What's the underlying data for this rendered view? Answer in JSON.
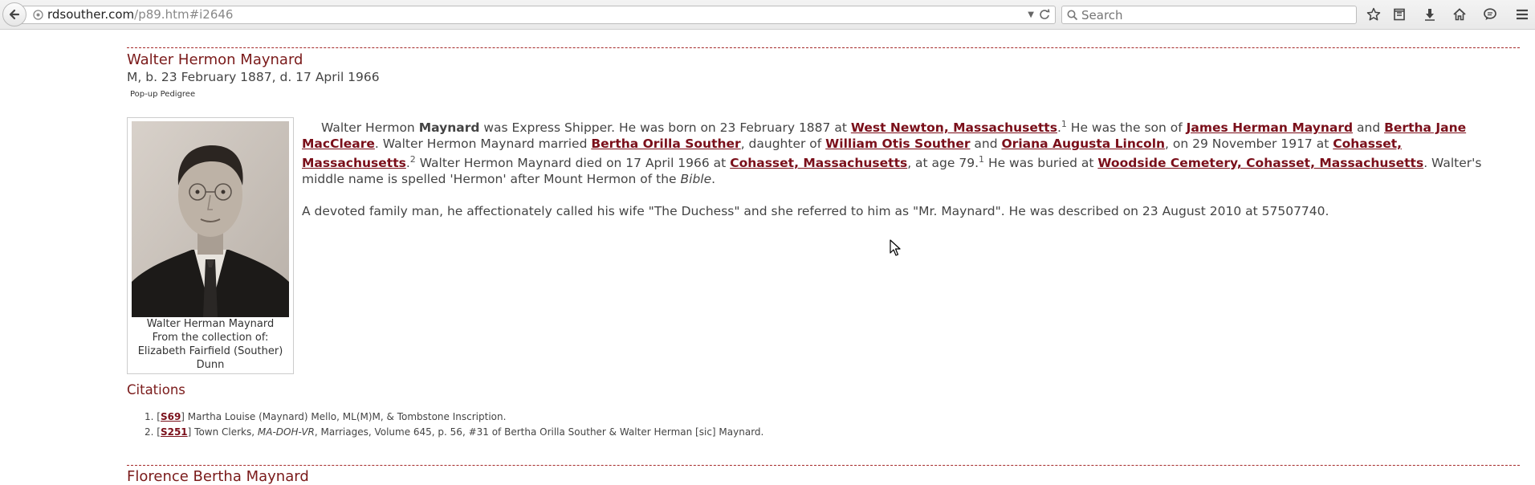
{
  "browser": {
    "url_host": "rdsouther.com",
    "url_path": "/p89.htm#i2646",
    "search_placeholder": "Search"
  },
  "person": {
    "name": "Walter Hermon Maynard",
    "dates": "M, b. 23 February 1887, d. 17 April 1966",
    "popup_pedigree": "Pop-up Pedigree",
    "photo_caption": [
      "Walter Herman Maynard",
      "From the collection of:",
      "Elizabeth Fairfield (Souther)",
      "Dunn"
    ]
  },
  "bio": {
    "p1": {
      "t1": "Walter Hermon ",
      "surname": "Maynard",
      "t2": " was Express Shipper. He was born on 23 February 1887 at ",
      "l1": "West Newton, Massachusetts",
      "t3": ".",
      "s1": "1",
      "t4": " He was the son of ",
      "l2": "James Herman Maynard",
      "t5": " and ",
      "l3": "Bertha Jane MacCleare",
      "t6": ". Walter Hermon Maynard married ",
      "l4": "Bertha Orilla Souther",
      "t7": ", daughter of ",
      "l5": "William Otis Souther",
      "t8": " and ",
      "l6": "Oriana Augusta Lincoln",
      "t9": ", on 29 November 1917 at ",
      "l7": "Cohasset, Massachusetts",
      "t10": ".",
      "s2": "2",
      "t11": " Walter Hermon Maynard died on 17 April 1966 at ",
      "l8": "Cohasset, Massachusetts",
      "t12": ", at age 79.",
      "s3": "1",
      "t13": " He was buried at ",
      "l9": "Woodside Cemetery, Cohasset, Massachusetts",
      "t14": ". Walter's middle name is spelled 'Hermon' after Mount Hermon of the ",
      "em": "Bible",
      "t15": "."
    },
    "p2": "A devoted family man, he affectionately called his wife \"The Duchess\" and she referred to him as \"Mr. Maynard\". He was described on 23 August 2010 at 57507740."
  },
  "citations": {
    "heading": "Citations",
    "items": [
      {
        "num": "1.",
        "source": "S69",
        "pre": "] Martha Louise (Maynard) Mello, ML(M)M, & Tombstone Inscription.",
        "em": "",
        "post": ""
      },
      {
        "num": "2.",
        "source": "S251",
        "pre": "] Town Clerks, ",
        "em": "MA-DOH-VR",
        "post": ", Marriages, Volume 645, p. 56, #31 of Bertha Orilla Souther & Walter Herman [sic] Maynard."
      }
    ]
  },
  "next_person": "Florence Bertha Maynard",
  "colors": {
    "link": "#7a0f1a",
    "heading": "#7a1a1a",
    "rule": "#a52a2a"
  }
}
